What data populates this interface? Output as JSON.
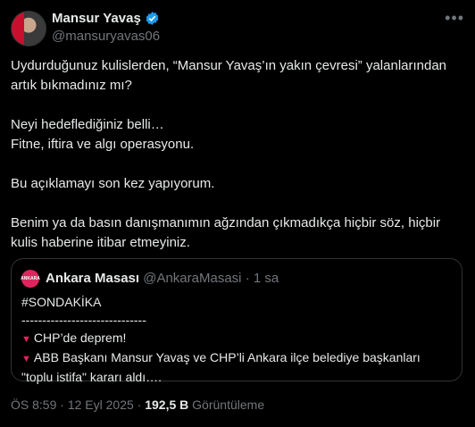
{
  "author": {
    "name": "Mansur Yavaş",
    "handle": "@mansuryavas06"
  },
  "tweet": {
    "lines": [
      "Uydurduğunuz kulislerden, “Mansur Yavaş’ın yakın çevresi” yalanlarından artık bıkmadınız mı?",
      "",
      "Neyi hedeflediğiniz belli…",
      "Fitne, iftira ve algı operasyonu.",
      "",
      "Bu açıklamayı son kez yapıyorum.",
      "",
      "Benim ya da basın danışmanımın ağzından çıkmadıkça hiçbir söz, hiçbir kulis haberine itibar etmeyiniz."
    ]
  },
  "quote": {
    "avatar_text": "ANKARA",
    "name": "Ankara Masası",
    "handle": "@AnkaraMasasi",
    "separator": "·",
    "time": "1 sa",
    "line1": "#SONDAKİKA",
    "line2": "------------------------------",
    "item1": "CHP’de deprem!",
    "item2": "ABB Başkanı Mansur Yavaş ve CHP’li Ankara ilçe belediye başkanları \"toplu istifa\" kararı aldı…."
  },
  "meta": {
    "time": "ÖS 8:59",
    "separator": "·",
    "date": "12 Eyl 2025",
    "views_count": "192,5 B",
    "views_label": "Görüntüleme"
  },
  "icons": {
    "verified": "verified-badge-icon",
    "more": "more-icon",
    "triangle": "red-triangle-icon"
  },
  "colors": {
    "background": "#000000",
    "text": "#e7e9ea",
    "muted": "#71767b",
    "verified": "#1d9bf0",
    "triangle": "#e0245e"
  }
}
